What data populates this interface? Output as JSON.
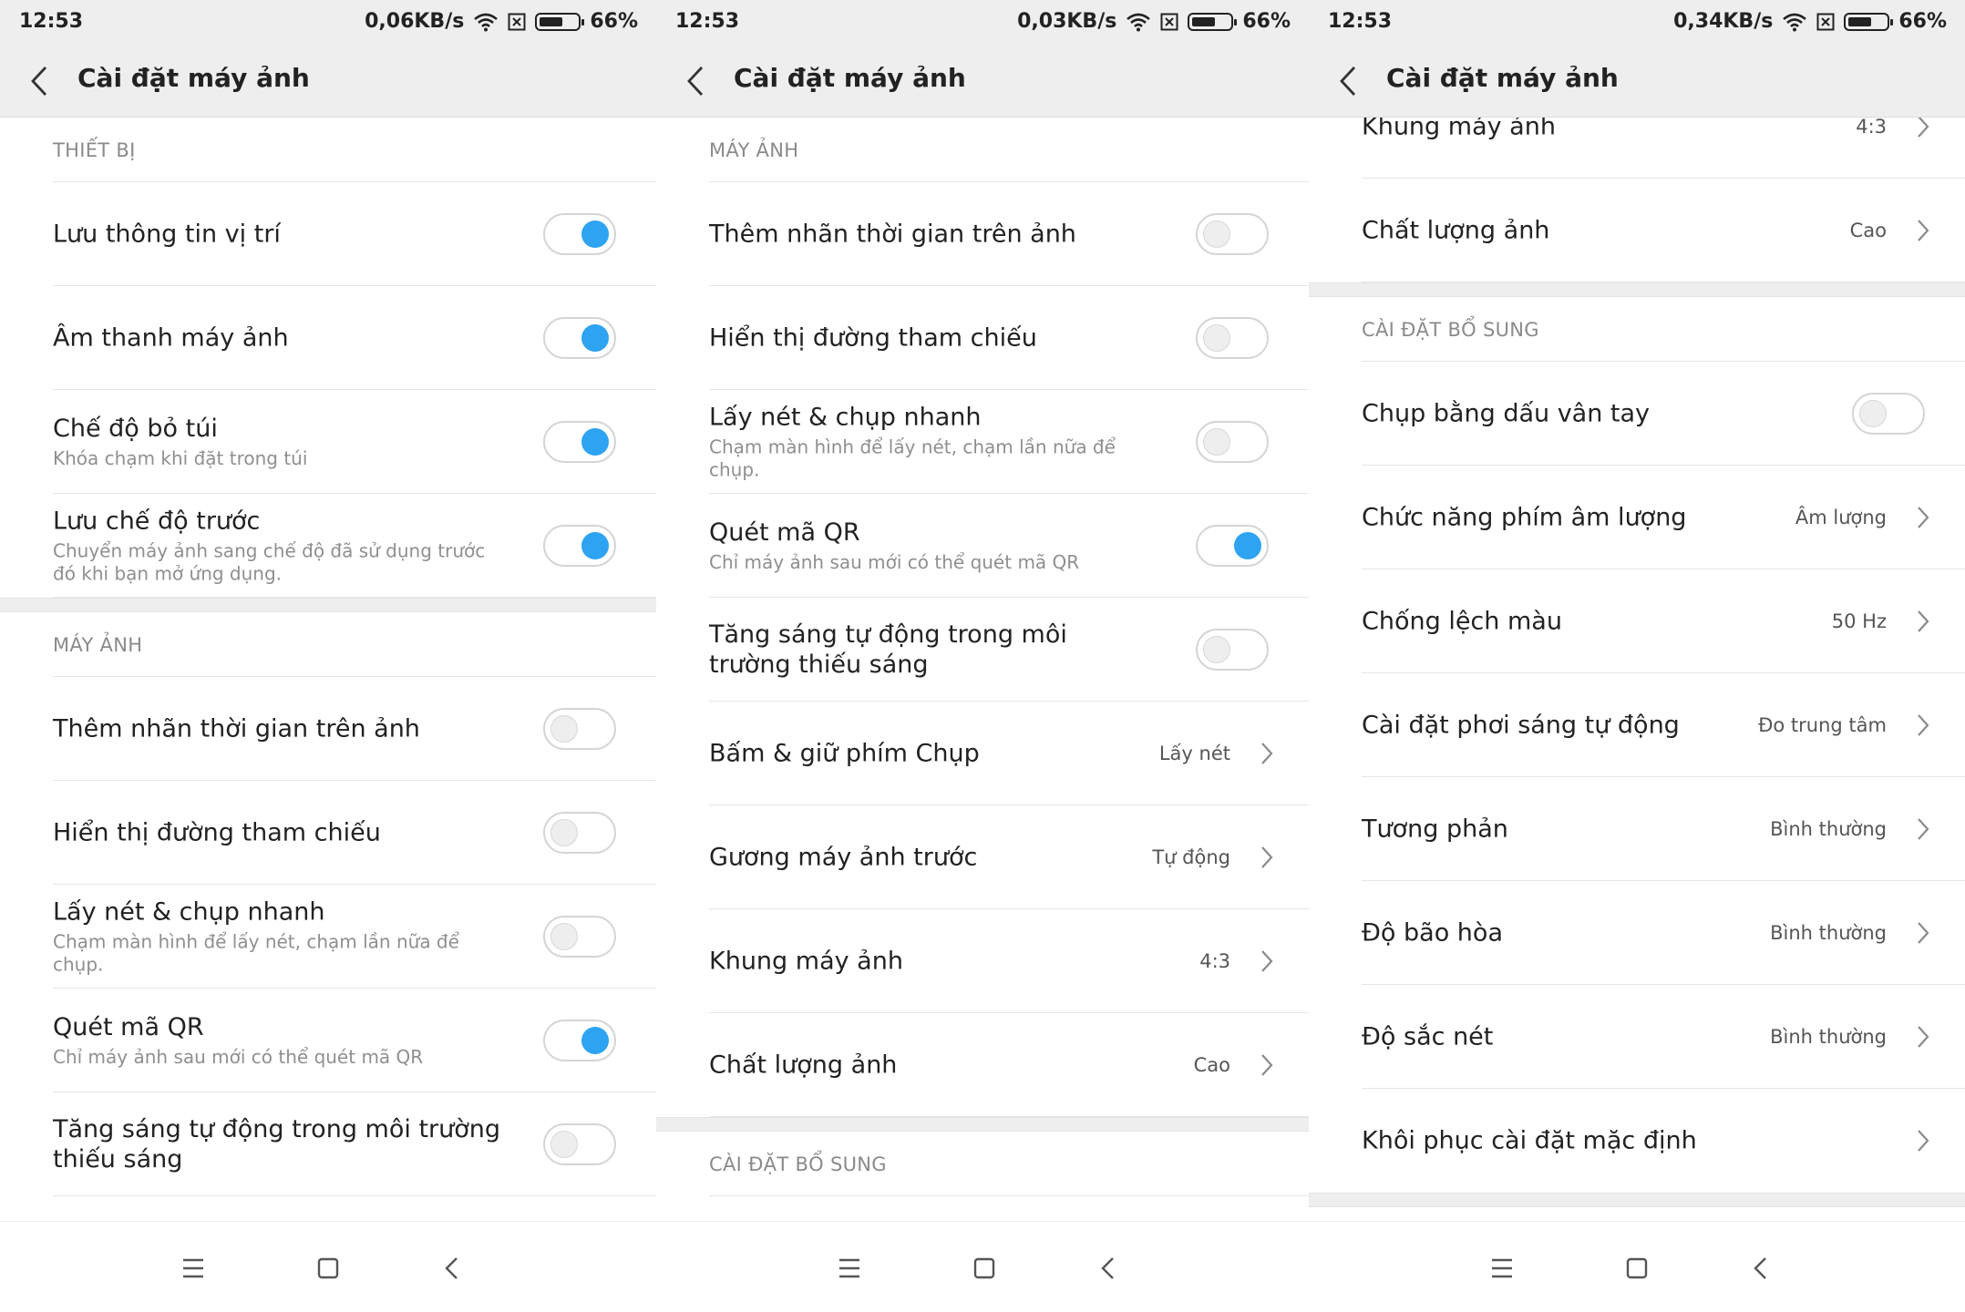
{
  "screens": [
    {
      "status": {
        "time": "12:53",
        "speed": "0,06KB/s",
        "battery": "66%",
        "battery_level": 0.66
      },
      "header": {
        "title": "Cài đặt máy ảnh"
      },
      "sections": [
        {
          "header": "THIẾT BỊ",
          "rows": [
            {
              "title": "Lưu thông tin vị trí",
              "control": "toggle",
              "on": true
            },
            {
              "title": "Âm thanh máy ảnh",
              "control": "toggle",
              "on": true
            },
            {
              "title": "Chế độ bỏ túi",
              "subtitle": "Khóa chạm khi đặt trong túi",
              "control": "toggle",
              "on": true
            },
            {
              "title": "Lưu chế độ trước",
              "subtitle": "Chuyển máy ảnh sang chế độ đã sử dụng trước đó khi bạn mở ứng dụng.",
              "control": "toggle",
              "on": true
            }
          ]
        },
        {
          "header": "MÁY ẢNH",
          "rows": [
            {
              "title": "Thêm nhãn thời gian trên ảnh",
              "control": "toggle",
              "on": false
            },
            {
              "title": "Hiển thị đường tham chiếu",
              "control": "toggle",
              "on": false
            },
            {
              "title": "Lấy nét & chụp nhanh",
              "subtitle": "Chạm màn hình để lấy nét, chạm lần nữa để chụp.",
              "control": "toggle",
              "on": false
            },
            {
              "title": "Quét mã QR",
              "subtitle": "Chỉ máy ảnh sau mới có thể quét mã QR",
              "control": "toggle",
              "on": true
            },
            {
              "title": "Tăng sáng tự động trong môi trường thiếu sáng",
              "control": "toggle",
              "on": false
            }
          ]
        }
      ]
    },
    {
      "status": {
        "time": "12:53",
        "speed": "0,03KB/s",
        "battery": "66%",
        "battery_level": 0.66
      },
      "header": {
        "title": "Cài đặt máy ảnh"
      },
      "sections": [
        {
          "header": "MÁY ẢNH",
          "rows": [
            {
              "title": "Thêm nhãn thời gian trên ảnh",
              "control": "toggle",
              "on": false
            },
            {
              "title": "Hiển thị đường tham chiếu",
              "control": "toggle",
              "on": false
            },
            {
              "title": "Lấy nét & chụp nhanh",
              "subtitle": "Chạm màn hình để lấy nét, chạm lần nữa để chụp.",
              "control": "toggle",
              "on": false
            },
            {
              "title": "Quét mã QR",
              "subtitle": "Chỉ máy ảnh sau mới có thể quét mã QR",
              "control": "toggle",
              "on": true
            },
            {
              "title": "Tăng sáng tự động trong môi trường thiếu sáng",
              "control": "toggle",
              "on": false
            },
            {
              "title": "Bấm & giữ phím Chụp",
              "control": "value",
              "value": "Lấy nét"
            },
            {
              "title": "Gương máy ảnh trước",
              "control": "value",
              "value": "Tự động"
            },
            {
              "title": "Khung máy ảnh",
              "control": "value",
              "value": "4:3"
            },
            {
              "title": "Chất lượng ảnh",
              "control": "value",
              "value": "Cao"
            }
          ]
        },
        {
          "header": "CÀI ĐẶT BỔ SUNG",
          "rows": []
        }
      ]
    },
    {
      "status": {
        "time": "12:53",
        "speed": "0,34KB/s",
        "battery": "66%",
        "battery_level": 0.66
      },
      "header": {
        "title": "Cài đặt máy ảnh"
      },
      "sections": [
        {
          "header": "",
          "rows": [
            {
              "title": "Khung máy ảnh",
              "control": "value",
              "value": "4:3"
            },
            {
              "title": "Chất lượng ảnh",
              "control": "value",
              "value": "Cao"
            }
          ]
        },
        {
          "header": "CÀI ĐẶT BỔ SUNG",
          "rows": [
            {
              "title": "Chụp bằng dấu vân tay",
              "control": "toggle",
              "on": false
            },
            {
              "title": "Chức năng phím âm lượng",
              "control": "value",
              "value": "Âm lượng"
            },
            {
              "title": "Chống lệch màu",
              "control": "value",
              "value": "50 Hz"
            },
            {
              "title": "Cài đặt phơi sáng tự động",
              "control": "value",
              "value": "Đo trung tâm"
            },
            {
              "title": "Tương phản",
              "control": "value",
              "value": "Bình thường"
            },
            {
              "title": "Độ bão hòa",
              "control": "value",
              "value": "Bình thường"
            },
            {
              "title": "Độ sắc nét",
              "control": "value",
              "value": "Bình thường"
            },
            {
              "title": "Khôi phục cài đặt mặc định",
              "control": "chevron"
            }
          ]
        }
      ]
    }
  ],
  "colors": {
    "accent": "#2ea3f2",
    "bar_bg": "#eeeeee",
    "divider": "#e6e6e6"
  },
  "icons": {
    "wifi": "wifi-icon",
    "sim": "no-sim-icon",
    "battery": "battery-icon",
    "back": "back-arrow-icon",
    "chevron": "chevron-right-icon",
    "nav_menu": "menu-icon",
    "nav_home": "home-icon",
    "nav_back": "back-icon"
  }
}
